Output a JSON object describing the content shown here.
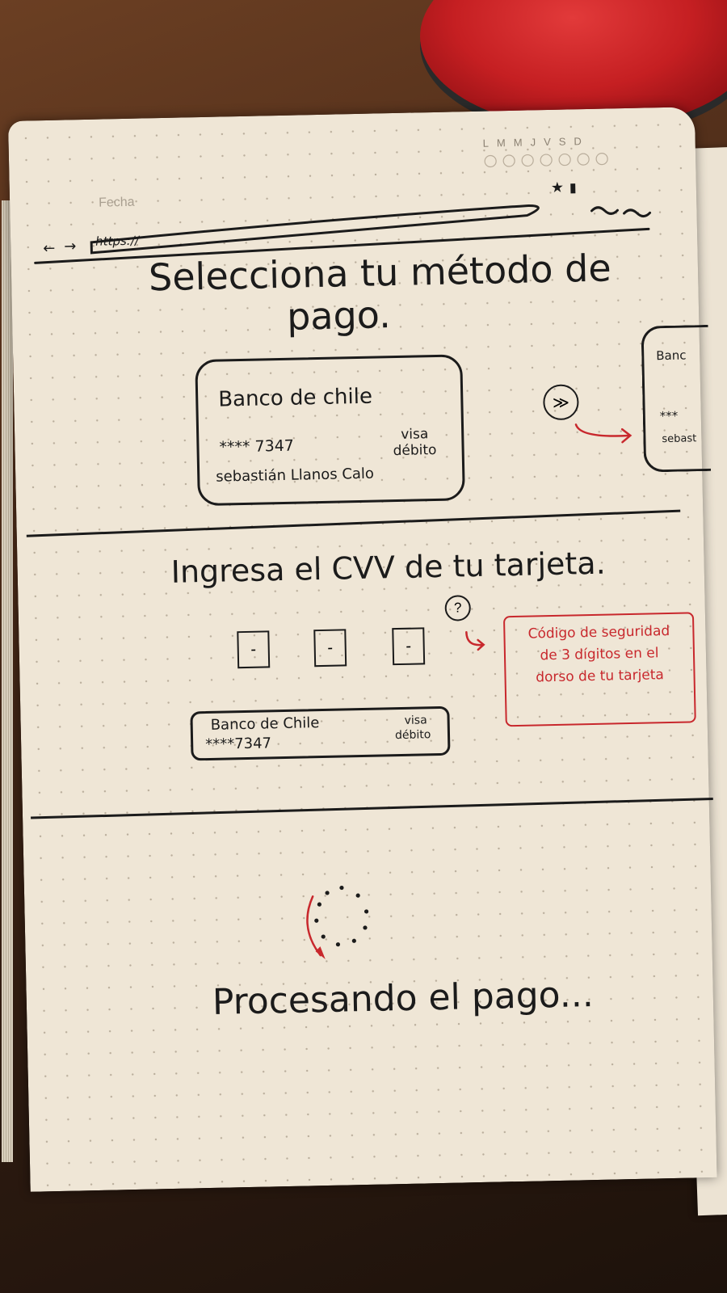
{
  "notebook": {
    "date_label": "Fecha",
    "weekdays": [
      "L",
      "M",
      "M",
      "J",
      "V",
      "S",
      "D"
    ]
  },
  "browser": {
    "url": "https://"
  },
  "screen1": {
    "title_line1": "Selecciona tu método de",
    "title_line2": "pago.",
    "card": {
      "bank": "Banco de chile",
      "number": "**** 7347",
      "type_line1": "visa",
      "type_line2": "débito",
      "holder": "sebastián Llanos Calo"
    },
    "next_card": {
      "bank": "Banc",
      "number": "***",
      "holder": "sebast"
    },
    "next_icon": "arrow-right-icon"
  },
  "screen2": {
    "title": "Ingresa el CVV de tu tarjeta.",
    "cvv_placeholder": "-",
    "help_symbol": "?",
    "tooltip_line1": "Código de seguridad",
    "tooltip_line2": "de 3 dígitos en el",
    "tooltip_line3": "dorso de tu tarjeta",
    "card": {
      "bank": "Banco de Chile",
      "number": "****7347",
      "type_line1": "visa",
      "type_line2": "débito"
    }
  },
  "screen3": {
    "status": "Procesando el pago...",
    "spinner_icon": "loading-spinner-icon"
  },
  "colors": {
    "ink": "#1b1b1b",
    "accent_red": "#c8282d",
    "paper": "#efe6d6"
  }
}
